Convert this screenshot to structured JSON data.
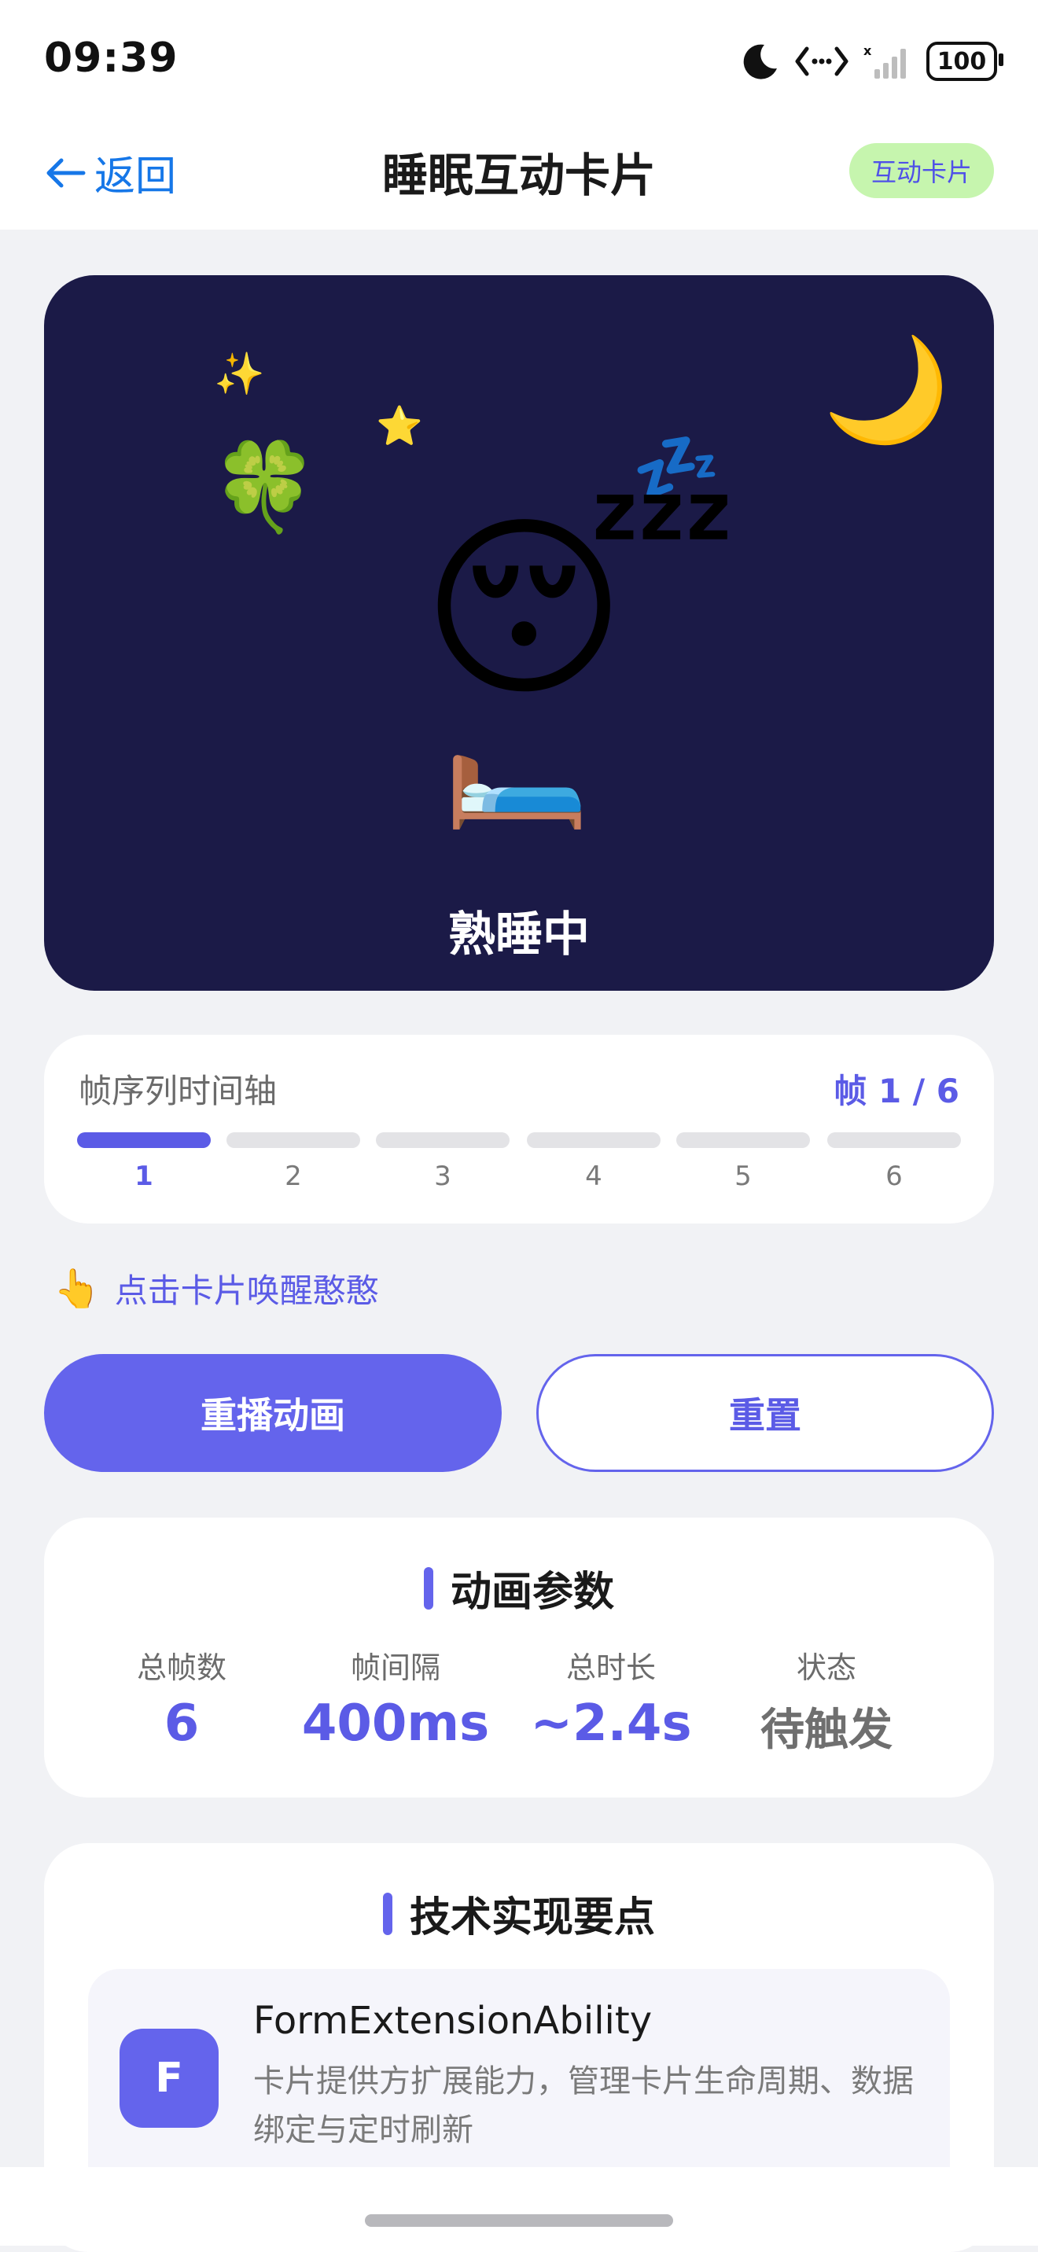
{
  "status_bar": {
    "time": "09:39",
    "battery": "100",
    "icons": [
      "moon-icon",
      "link-icon",
      "signal-icon",
      "battery-icon"
    ]
  },
  "nav": {
    "back_label": "返回",
    "title": "睡眠互动卡片",
    "badge": "互动卡片"
  },
  "hero": {
    "status_text": "熟睡中",
    "emojis": {
      "sparkles": "✨",
      "star": "⭐",
      "clover": "🍀",
      "moon": "🌙",
      "zzz": "💤",
      "sleeping_face": "😴",
      "bed": "🛏️"
    },
    "background": "#1B1A47"
  },
  "timeline": {
    "title": "帧序列时间轴",
    "frame_label": "帧 1 / 6",
    "current_frame": 1,
    "frames": [
      "1",
      "2",
      "3",
      "4",
      "5",
      "6"
    ]
  },
  "hint": {
    "icon": "👆",
    "text": "点击卡片唤醒憨憨"
  },
  "buttons": {
    "replay": "重播动画",
    "reset": "重置"
  },
  "params": {
    "title": "动画参数",
    "stats": [
      {
        "label": "总帧数",
        "value": "6"
      },
      {
        "label": "帧间隔",
        "value": "400ms"
      },
      {
        "label": "总时长",
        "value": "~2.4s"
      },
      {
        "label": "状态",
        "value": "待触发"
      }
    ]
  },
  "tech": {
    "title": "技术实现要点",
    "items": [
      {
        "icon_letter": "F",
        "name": "FormExtensionAbility",
        "desc": "卡片提供方扩展能力，管理卡片生命周期、数据绑定与定时刷新"
      }
    ]
  },
  "colors": {
    "accent": "#5B5BE6",
    "link": "#1677E8",
    "badge_bg": "#C6F5AE"
  }
}
